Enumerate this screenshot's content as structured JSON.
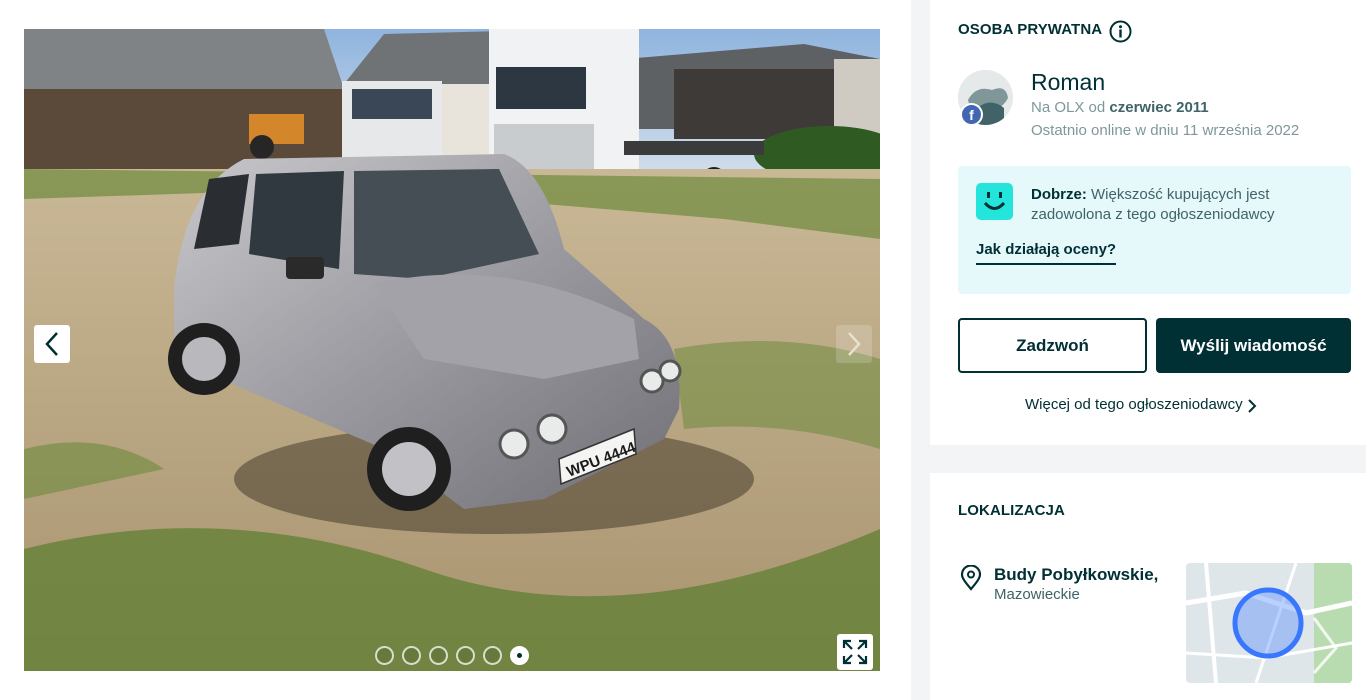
{
  "gallery": {
    "prev_label": "Previous photo",
    "next_label": "Next photo",
    "fullscreen_label": "Fullscreen",
    "photo_count": 6,
    "active_photo": 6,
    "plate_text": "WPU 4444"
  },
  "seller": {
    "section_title": "OSOBA PRYWATNA",
    "name": "Roman",
    "since_prefix": "Na OLX od",
    "since_date": "czerwiec 2011",
    "last_online": "Ostatnio online w dniu 11 września 2022",
    "fb_badge": "f"
  },
  "rating": {
    "label": "Dobrze:",
    "text": "Większość kupujących jest zadowolona z tego ogłoszeniodawcy",
    "link": "Jak działają oceny?"
  },
  "actions": {
    "call_label": "Zadzwoń",
    "message_label": "Wyślij wiadomość",
    "more_label": "Więcej od tego ogłoszeniodawcy"
  },
  "location": {
    "section_title": "LOKALIZACJA",
    "city": "Budy Pobyłkowskie,",
    "region": "Mazowieckie"
  },
  "colors": {
    "brand_dark": "#002f34",
    "rating_bg": "#e5f9fb",
    "smiley": "#23e5db",
    "map_marker": "#3a77ff"
  },
  "icons": [
    "chevron-left-icon",
    "chevron-right-icon",
    "expand-icon",
    "info-icon",
    "facebook-icon",
    "smiley-icon",
    "chevron-right-small-icon",
    "location-pin-icon"
  ]
}
